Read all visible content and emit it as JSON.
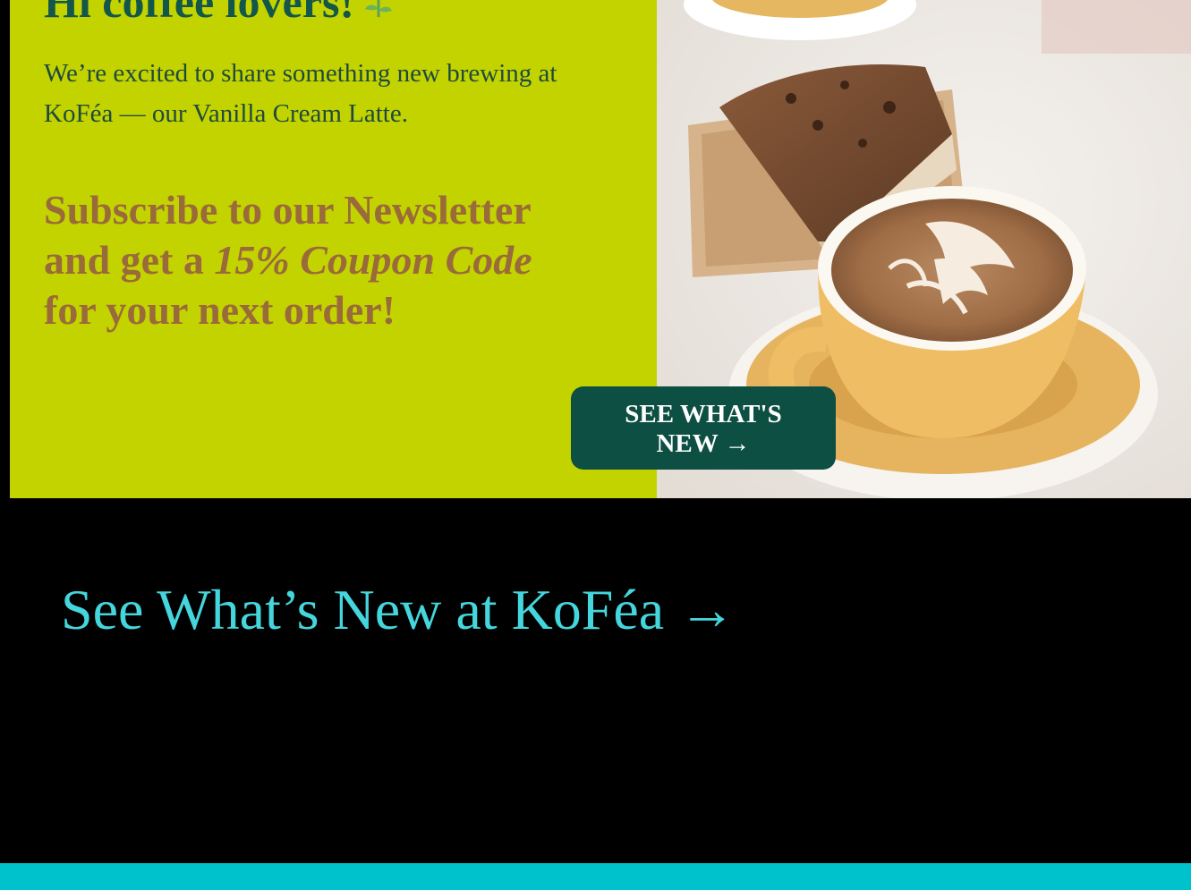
{
  "banner": {
    "greeting": "Hi coffee lovers!",
    "intro": "We’re excited to share something new brewing at KoFéa — our Vanilla Cream Latte.",
    "promo": {
      "line1": "Subscribe to our Newsletter",
      "line2_prefix": "and get a ",
      "line2_emphasis": "15% Coupon Code",
      "line3": "for your next order!"
    },
    "button": {
      "line1": "SEE WHAT'S",
      "line2": "NEW →"
    },
    "icons": {
      "greeting_icon": "flower-icon"
    },
    "colors": {
      "background": "#c2d300",
      "greeting": "#13564a",
      "promo": "#9a6a3a",
      "button": "#0e4f43"
    }
  },
  "cta": {
    "label": "See What’s New at KoFéa →",
    "color": "#44d6dc"
  },
  "footer": {
    "bar_color": "#00c2cc"
  }
}
